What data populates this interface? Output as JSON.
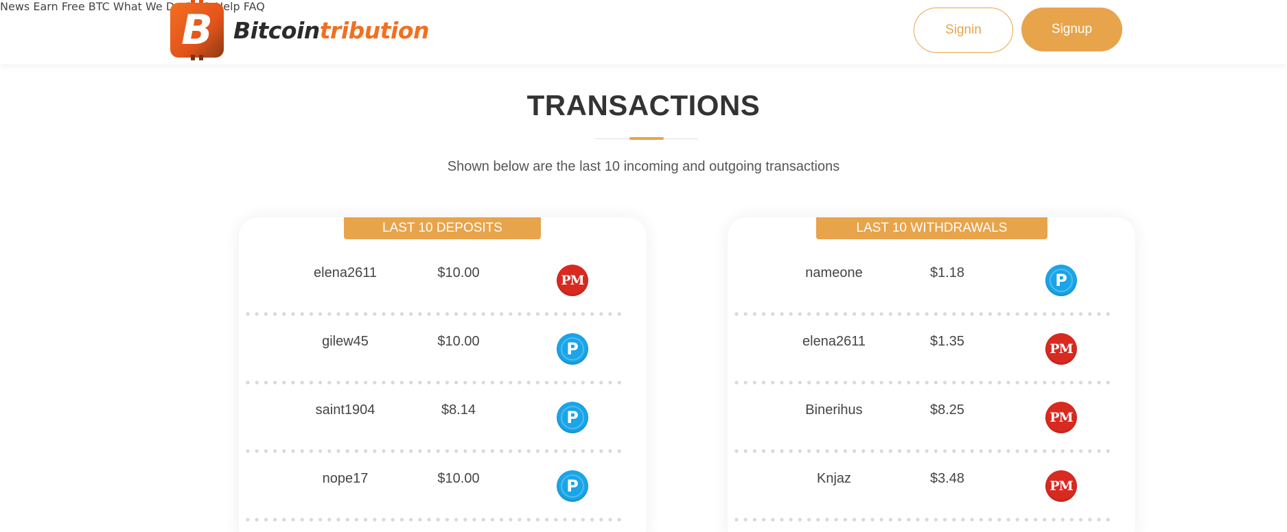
{
  "header": {
    "logo": {
      "letter": "B",
      "text_dark": "Bitcoin",
      "text_orange": "tribution"
    },
    "nav": [
      "News",
      "Earn Free BTC",
      "What We Do",
      "Seek Help",
      "FAQ"
    ],
    "signin_label": "Signin",
    "signup_label": "Signup"
  },
  "page": {
    "title": "TRANSACTIONS",
    "subtitle": "Shown below are the last 10 incoming and outgoing transactions"
  },
  "deposits": {
    "heading": "LAST 10 DEPOSITS",
    "rows": [
      {
        "name": "elena2611",
        "amount": "$10.00",
        "method": "PM"
      },
      {
        "name": "gilew45",
        "amount": "$10.00",
        "method": "P"
      },
      {
        "name": "saint1904",
        "amount": "$8.14",
        "method": "P"
      },
      {
        "name": "nope17",
        "amount": "$10.00",
        "method": "P"
      }
    ]
  },
  "withdrawals": {
    "heading": "LAST 10 WITHDRAWALS",
    "rows": [
      {
        "name": "nameone",
        "amount": "$1.18",
        "method": "P"
      },
      {
        "name": "elena2611",
        "amount": "$1.35",
        "method": "PM"
      },
      {
        "name": "Binerihus",
        "amount": "$8.25",
        "method": "PM"
      },
      {
        "name": "Knjaz",
        "amount": "$3.48",
        "method": "PM"
      }
    ]
  },
  "colors": {
    "accent": "#e8a44a",
    "logo_orange": "#f26f21",
    "perfect_money_red": "#d92a21",
    "payeer_blue": "#1aa5e8"
  },
  "icons": {
    "PM": "perfect-money-icon",
    "P": "payeer-icon"
  }
}
